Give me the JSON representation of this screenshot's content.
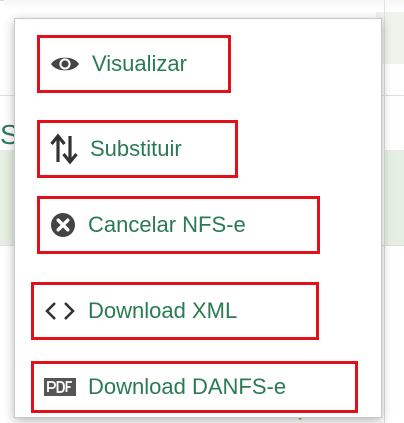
{
  "menu": {
    "items": [
      {
        "label": "Visualizar",
        "icon": "eye-icon"
      },
      {
        "label": "Substituir",
        "icon": "swap-arrows-icon"
      },
      {
        "label": "Cancelar NFS-e",
        "icon": "cancel-circle-icon"
      },
      {
        "label": "Download XML",
        "icon": "code-icon"
      },
      {
        "label": "Download DANFS-e",
        "icon": "pdf-icon"
      }
    ]
  },
  "background": {
    "partial_text": "S"
  },
  "colors": {
    "menu_text": "#2a7a52",
    "highlight_border": "#e3101c",
    "icon": "#444444",
    "background_accent": "#e6efe3"
  }
}
